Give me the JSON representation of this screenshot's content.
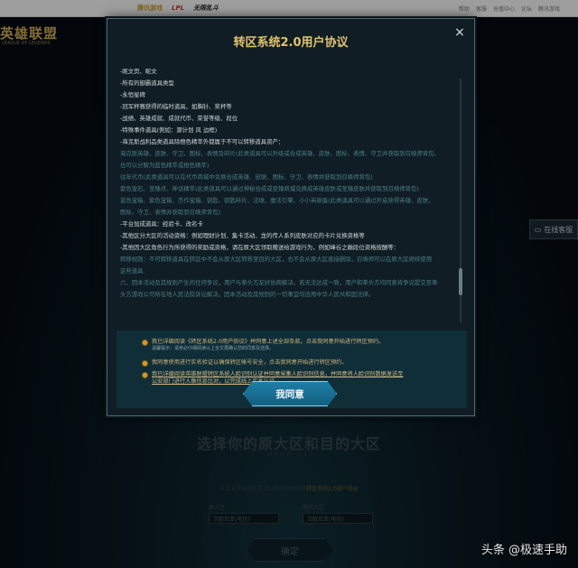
{
  "topbar": {
    "logo_tencent": "腾讯游戏",
    "logo_lpl": "LPL",
    "logo_event": "无限乱斗",
    "links": [
      "帮助",
      "客服",
      "充值中心",
      "论坛",
      "腾讯游戏"
    ]
  },
  "site_logo": "英雄联盟",
  "site_logo_sub": "LEAGUE OF LEGENDS",
  "online_service": "在线客服",
  "background": {
    "title": "选择你的原大区和目的大区",
    "step": "STEP 01",
    "notice": "在正式开始转区前请认真阅读并同意",
    "notice_link": "转区系统2.0用户协议",
    "from_label": "原大区",
    "to_label": "目的大区",
    "from_value": "艾欧尼亚(电信)",
    "to_value": "艾欧尼亚(电信)",
    "confirm": "确定"
  },
  "modal": {
    "title": "转区系统2.0用户协议",
    "close": "×",
    "lines": [
      {
        "c": "w",
        "t": "-昵文页、昵文"
      },
      {
        "c": "w",
        "t": "-所有的御霸道具类型"
      },
      {
        "c": "w",
        "t": "-永恒星碑"
      },
      {
        "c": "w",
        "t": "-冠军杯赛获得的临时道具、如胸针、奖杯等"
      },
      {
        "c": "w",
        "t": "-战绩、英雄成就、成就代币、荣誉等级、段位"
      },
      {
        "c": "w",
        "t": "-特殊事件道具(例如：源计划 风 边框)"
      },
      {
        "c": "w",
        "t": "-海克斯战利品类道具除橙色精萃外都属于不可以转移道具资产："
      },
      {
        "c": "b",
        "t": "海克斯英雄、皮肤、守卫、图标、表情及碎片(此类道具可以升级或合成英雄、皮肤、图标、表情、守卫并获取到召唤师背包、"
      },
      {
        "c": "b",
        "t": "也可以分解为蓝色精萃或橙色精萃)"
      },
      {
        "c": "b",
        "t": "往年代币(此类道具可以在代币商城中兑换合成英雄、皮肤、图标、守卫、表情并获取到召唤师背包)"
      },
      {
        "c": "b",
        "t": "紫色宝石、至臻点、神话精萃(此类道具可以通过神秘合成或至臻商城兑换成英雄皮肤或至臻皮肤并获取到召唤师背包)"
      },
      {
        "c": "b",
        "t": "蓝色宝箱、紫色宝箱、杰作宝箱、钥匙、钥匙碎片、法球、魔法引擎、小小英雄蛋(此类道具可以通过开启获得英雄、皮肤、"
      },
      {
        "c": "b",
        "t": "图标、守卫、表情并获取到召唤师背包)"
      },
      {
        "c": "w",
        "t": "-平台加成道具：经验卡、改名卡"
      },
      {
        "c": "w",
        "t": "-其他区分大区的活动资格：例如理财计划、集卡活动、龙的传人系列皮肤对应的卡片兑换资格等"
      },
      {
        "c": "w",
        "t": "-其他因大区角色行为所获得的奖励或资格，请在原大区领取赠送给游戏行为，例如峰谷之巅段位资格按酬等："
      },
      {
        "c": "b",
        "t": "转移规则：不可转移道具在转区中不会从原大区转移至目的大区，也不会从原大区直接删除，召唤师可以在原大区继续使用"
      },
      {
        "c": "b",
        "t": "这些道具"
      },
      {
        "c": "b",
        "t": "六、因本活动及其规则产生的任何争议，用户与拳头方友好协商解决，若无法达成一致，用户和拳头方均同意将争议提交至拳"
      },
      {
        "c": "b",
        "t": "头方游戏公司所在地人民法院诉讼解决。因本活动及其规则的一切事宜均适用中华人民共和国法律。"
      }
    ],
    "checks": [
      {
        "text": "我已详细阅读《转区系统2.0用户协议》并同意上述全部条款。点击我同意开始进行转区预约。",
        "sub": "温馨提示：请务必仔细阅读以上全文再确认您的同意及选择。"
      },
      {
        "text": "我同意使用进行实名验证以确保转区帐号安全，点击我同意开始进行转区预约。",
        "sub": ""
      },
      {
        "text": "我已详细阅读英雄联盟转区系统人脸识别认证并同意采集人脸识别信息，并同意将人脸识别数据发送至",
        "text2": "公安部门进行人像信息比对，以完成线上实名认证。",
        "sub": ""
      }
    ],
    "agree_button": "我同意"
  },
  "watermark": "头条 @极速手助"
}
